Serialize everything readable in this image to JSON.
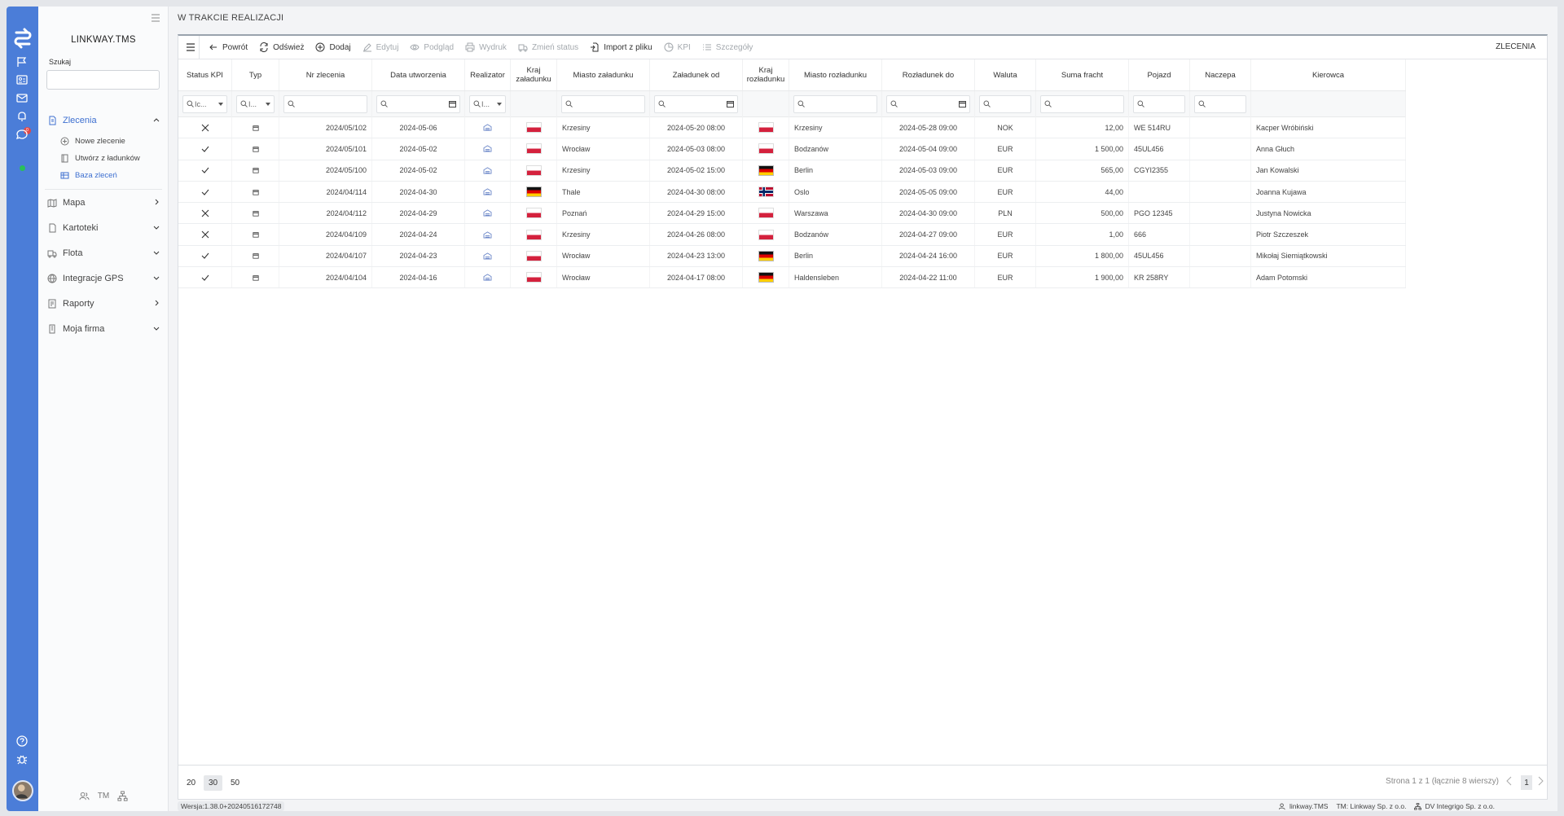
{
  "colors": {
    "accent": "#4b7dd8",
    "active_link": "#3d6fd0",
    "online": "#29c05a",
    "badge": "#e04848"
  },
  "rail": {
    "icons": [
      "swap-logo-icon",
      "flag-icon",
      "contact-card-icon",
      "mail-icon",
      "bell-icon",
      "chat-icon",
      "help-icon",
      "bug-icon"
    ],
    "badge_count": "0"
  },
  "sidebar": {
    "brand": "LINKWAY.TMS",
    "search_label": "Szukaj",
    "search_value": "",
    "nav": {
      "zlecenia": "Zlecenia",
      "sub": [
        "Nowe zlecenie",
        "Utwórz z ładunków",
        "Baza zleceń"
      ],
      "mapa": "Mapa",
      "kartoteki": "Kartoteki",
      "flota": "Flota",
      "gps": "Integracje GPS",
      "raporty": "Raporty",
      "firma": "Moja firma"
    },
    "bottom_label": "TM"
  },
  "page": {
    "title": "W TRAKCIE REALIZACJI",
    "section": "ZLECENIA"
  },
  "toolbar": {
    "back": "Powrót",
    "refresh": "Odśwież",
    "add": "Dodaj",
    "edit": "Edytuj",
    "preview": "Podgląd",
    "print": "Wydruk",
    "status": "Zmień status",
    "import": "Import z pliku",
    "kpi": "KPI",
    "details": "Szczegóły"
  },
  "table": {
    "headers": {
      "kpi": "Status KPI",
      "type": "Typ",
      "nr": "Nr zlecenia",
      "date": "Data utworzenia",
      "real": "Realizator",
      "kraj_z": "Kraj załadunku",
      "miasto_z": "Miasto załadunku",
      "zal_od": "Załadunek od",
      "kraj_r": "Kraj rozładunku",
      "miasto_r": "Miasto rozładunku",
      "roz_do": "Rozładunek do",
      "waluta": "Waluta",
      "suma": "Suma fracht",
      "pojazd": "Pojazd",
      "naczepa": "Naczepa",
      "kierowca": "Kierowca"
    },
    "filters": {
      "kpi": "Ic...",
      "type": "I...",
      "real": "I..."
    },
    "rows": [
      {
        "kpi": "x",
        "nr": "2024/05/102",
        "date": "2024-05-06",
        "kz": "pl",
        "mz": "Krzesiny",
        "od": "2024-05-20 08:00",
        "kr": "pl",
        "mr": "Krzesiny",
        "do": "2024-05-28 09:00",
        "cur": "NOK",
        "sum": "12,00",
        "veh": "WE 514RU",
        "trl": "",
        "drv": "Kacper Wróbiński"
      },
      {
        "kpi": "v",
        "nr": "2024/05/101",
        "date": "2024-05-02",
        "kz": "pl",
        "mz": "Wrocław",
        "od": "2024-05-03 08:00",
        "kr": "pl",
        "mr": "Bodzanów",
        "do": "2024-05-04 09:00",
        "cur": "EUR",
        "sum": "1 500,00",
        "veh": "45UL456",
        "trl": "",
        "drv": "Anna Głuch"
      },
      {
        "kpi": "v",
        "nr": "2024/05/100",
        "date": "2024-05-02",
        "kz": "pl",
        "mz": "Krzesiny",
        "od": "2024-05-02 15:00",
        "kr": "de",
        "mr": "Berlin",
        "do": "2024-05-03 09:00",
        "cur": "EUR",
        "sum": "565,00",
        "veh": "CGYI2355",
        "trl": "",
        "drv": "Jan Kowalski"
      },
      {
        "kpi": "v",
        "nr": "2024/04/114",
        "date": "2024-04-30",
        "kz": "de",
        "mz": "Thale",
        "od": "2024-04-30 08:00",
        "kr": "no",
        "mr": "Oslo",
        "do": "2024-05-05 09:00",
        "cur": "EUR",
        "sum": "44,00",
        "veh": "",
        "trl": "",
        "drv": "Joanna Kujawa"
      },
      {
        "kpi": "x",
        "nr": "2024/04/112",
        "date": "2024-04-29",
        "kz": "pl",
        "mz": "Poznań",
        "od": "2024-04-29 15:00",
        "kr": "pl",
        "mr": "Warszawa",
        "do": "2024-04-30 09:00",
        "cur": "PLN",
        "sum": "500,00",
        "veh": "PGO 12345",
        "trl": "",
        "drv": "Justyna Nowicka"
      },
      {
        "kpi": "x",
        "nr": "2024/04/109",
        "date": "2024-04-24",
        "kz": "pl",
        "mz": "Krzesiny",
        "od": "2024-04-26 08:00",
        "kr": "pl",
        "mr": "Bodzanów",
        "do": "2024-04-27 09:00",
        "cur": "EUR",
        "sum": "1,00",
        "veh": "666",
        "trl": "",
        "drv": "Piotr Szczeszek"
      },
      {
        "kpi": "v",
        "nr": "2024/04/107",
        "date": "2024-04-23",
        "kz": "pl",
        "mz": "Wrocław",
        "od": "2024-04-23 13:00",
        "kr": "de",
        "mr": "Berlin",
        "do": "2024-04-24 16:00",
        "cur": "EUR",
        "sum": "1 800,00",
        "veh": "45UL456",
        "trl": "",
        "drv": "Mikołaj Siemiątkowski"
      },
      {
        "kpi": "v",
        "nr": "2024/04/104",
        "date": "2024-04-16",
        "kz": "pl",
        "mz": "Wrocław",
        "od": "2024-04-17 08:00",
        "kr": "de",
        "mr": "Haldensleben",
        "do": "2024-04-22 11:00",
        "cur": "EUR",
        "sum": "1 900,00",
        "veh": "KR 258RY",
        "trl": "",
        "drv": "Adam Potomski"
      }
    ]
  },
  "pager": {
    "sizes": [
      "20",
      "30",
      "50"
    ],
    "selected": "30",
    "info": "Strona 1 z 1 (łącznie 8 wierszy)",
    "current": "1"
  },
  "status": {
    "version": "Wersja:1.38.0+20240516172748",
    "app": "linkway.TMS",
    "tm": "TM: Linkway Sp. z o.o.",
    "dv": "DV Integrigo Sp. z o.o."
  }
}
